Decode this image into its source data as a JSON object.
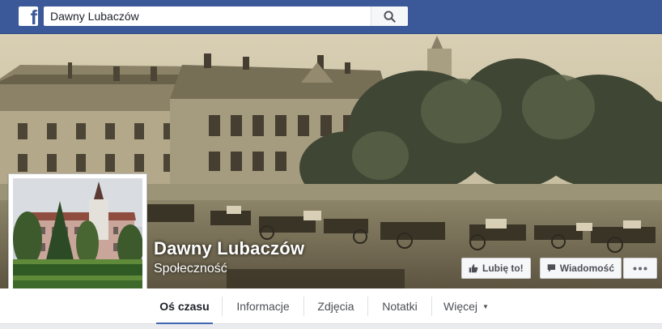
{
  "search": {
    "value": "Dawny Lubaczów"
  },
  "icons": {
    "logo": "facebook-f-icon",
    "search": "magnifier-icon",
    "like": "thumbs-up-icon",
    "message": "speech-bubble-icon",
    "more": "ellipsis-icon",
    "dropdown": "caret-down-icon"
  },
  "page": {
    "name": "Dawny Lubaczów",
    "category": "Społeczność"
  },
  "actions": {
    "like_label": "Lubię to!",
    "message_label": "Wiadomość"
  },
  "tabs": [
    {
      "label": "Oś czasu",
      "active": true
    },
    {
      "label": "Informacje"
    },
    {
      "label": "Zdjęcia"
    },
    {
      "label": "Notatki"
    },
    {
      "label": "Więcej"
    }
  ],
  "colors": {
    "brand": "#3b5998",
    "tab_active": "#4267b2",
    "cover_sepia": "#a49a7a"
  }
}
